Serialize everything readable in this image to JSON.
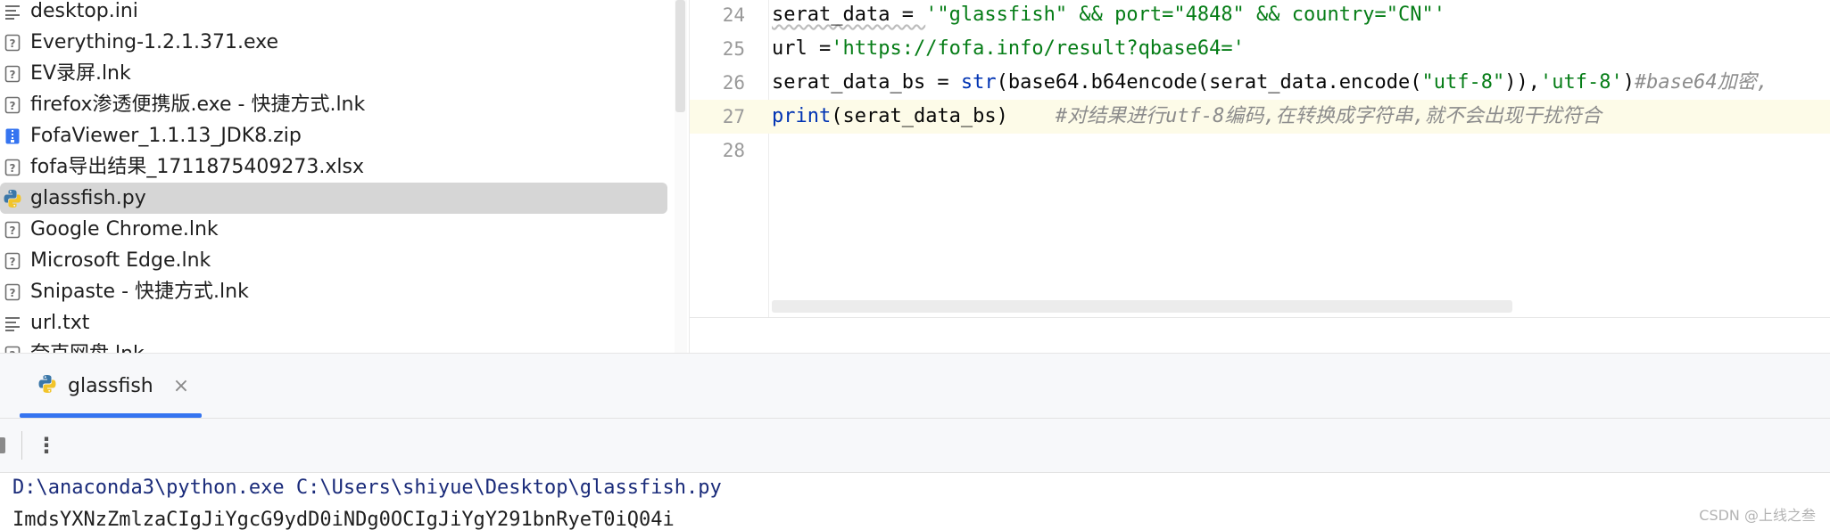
{
  "tree": {
    "items": [
      {
        "name": "desktop.ini",
        "icon": "text-file-icon"
      },
      {
        "name": "Everything-1.2.1.371.exe",
        "icon": "unknown-file-icon"
      },
      {
        "name": "EV录屏.lnk",
        "icon": "unknown-file-icon"
      },
      {
        "name": "firefox渗透便携版.exe - 快捷方式.lnk",
        "icon": "unknown-file-icon"
      },
      {
        "name": "FofaViewer_1.1.13_JDK8.zip",
        "icon": "zip-file-icon"
      },
      {
        "name": "fofa导出结果_1711875409273.xlsx",
        "icon": "unknown-file-icon"
      },
      {
        "name": "glassfish.py",
        "icon": "python-file-icon",
        "selected": true
      },
      {
        "name": "Google Chrome.lnk",
        "icon": "unknown-file-icon"
      },
      {
        "name": "Microsoft Edge.lnk",
        "icon": "unknown-file-icon"
      },
      {
        "name": "Snipaste - 快捷方式.lnk",
        "icon": "unknown-file-icon"
      },
      {
        "name": "url.txt",
        "icon": "text-file-icon"
      },
      {
        "name": "夸克网盘.lnk",
        "icon": "unknown-file-icon"
      }
    ]
  },
  "editor": {
    "lines": [
      {
        "num": "24",
        "parts": [
          {
            "t": "serat_data = ",
            "c": ""
          },
          {
            "t": "'\"glassfish\" && port=\"4848\" && country=\"CN\"'",
            "c": "str"
          }
        ]
      },
      {
        "num": "25",
        "parts": [
          {
            "t": "url =",
            "c": ""
          },
          {
            "t": "'https://fofa.info/result?qbase64='",
            "c": "str"
          }
        ]
      },
      {
        "num": "26",
        "parts": [
          {
            "t": "serat_data_bs = ",
            "c": ""
          },
          {
            "t": "str",
            "c": "fn"
          },
          {
            "t": "(base64.b64encode(serat_data.encode(",
            "c": ""
          },
          {
            "t": "\"utf-8\"",
            "c": "str"
          },
          {
            "t": ")),",
            "c": ""
          },
          {
            "t": "'utf-8'",
            "c": "str"
          },
          {
            "t": ")",
            "c": ""
          },
          {
            "t": "#base64加密,",
            "c": "cmt"
          }
        ]
      },
      {
        "num": "27",
        "current": true,
        "parts": [
          {
            "t": "print",
            "c": "fn"
          },
          {
            "t": "(serat_data_bs)    ",
            "c": ""
          },
          {
            "t": "#对结果进行utf-8编码,在转换成字符串,就不会出现干扰符合",
            "c": "cmt"
          }
        ]
      },
      {
        "num": "28",
        "parts": []
      }
    ]
  },
  "run": {
    "tab_label": "glassfish",
    "close_glyph": "×",
    "more_glyph": "⋮"
  },
  "console": {
    "command": "D:\\anaconda3\\python.exe C:\\Users\\shiyue\\Desktop\\glassfish.py",
    "output": "ImdsYXNzZmlzaCIgJiYgcG9ydD0iNDg0OCIgJiYgY291bnRyeT0iQ04i"
  },
  "watermark": "CSDN @上线之叁",
  "colors": {
    "accent": "#3574f0",
    "selected_row": "#d6d6d6",
    "string": "#067d17",
    "keyword_fn": "#0033b3",
    "comment": "#8c8c8c",
    "current_line": "#fdfbe8"
  }
}
